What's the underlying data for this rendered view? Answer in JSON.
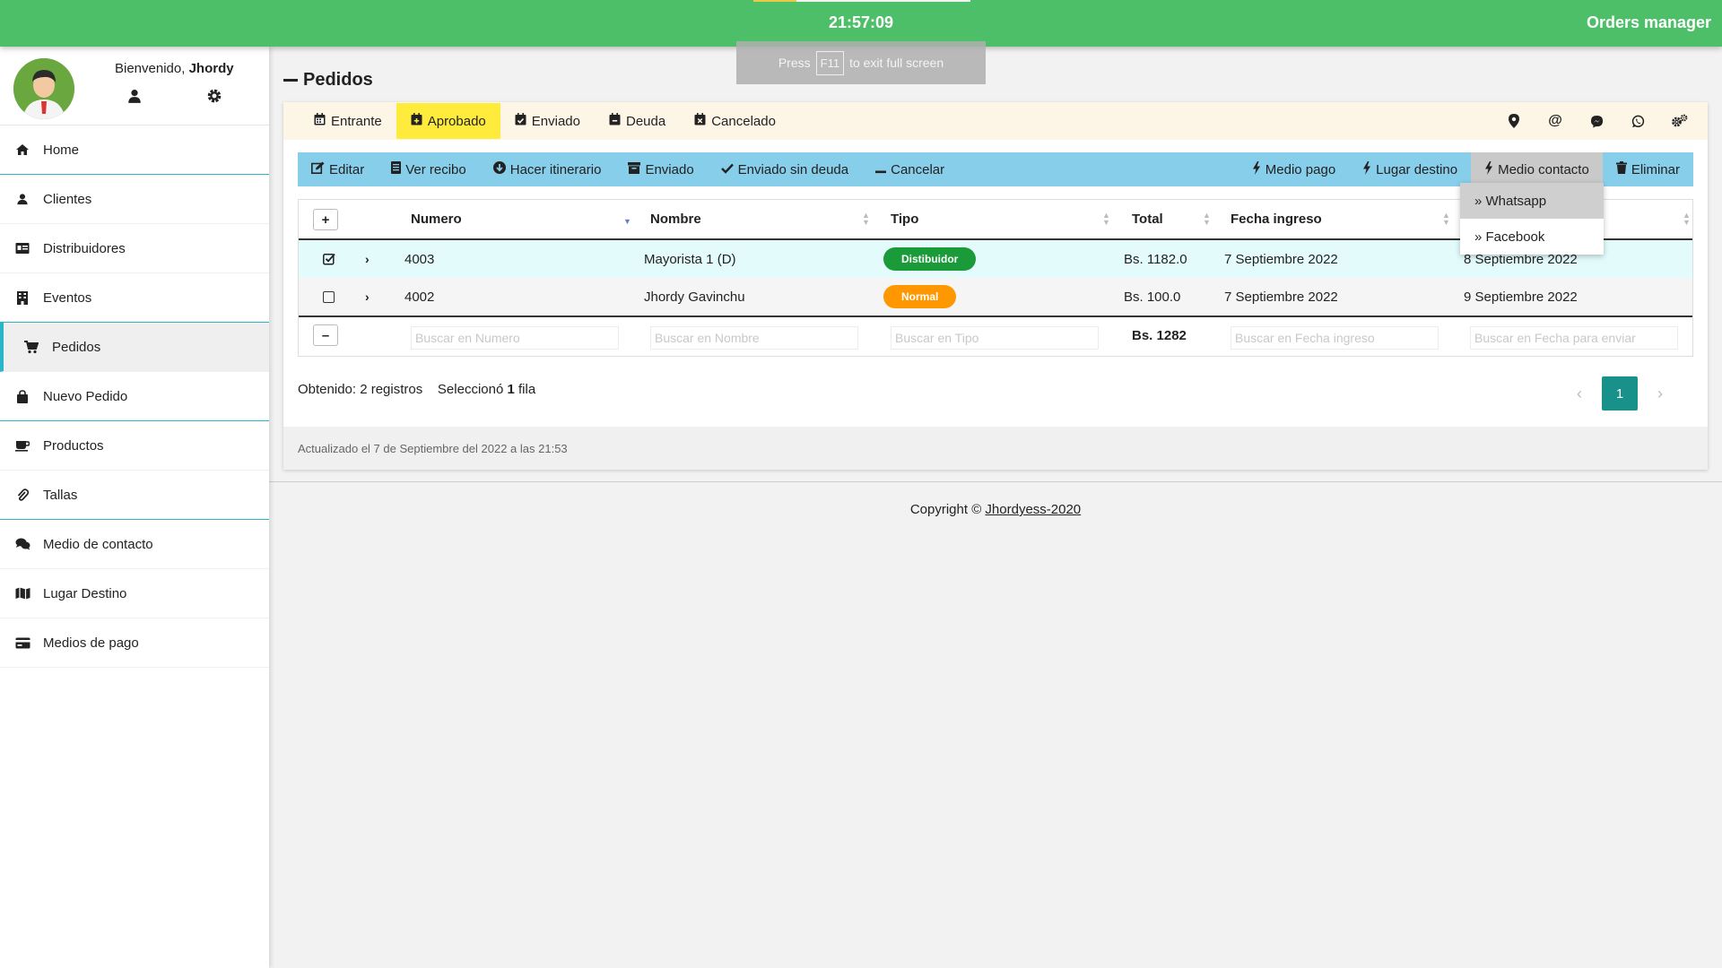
{
  "header": {
    "clock": "21:57:09",
    "app_title": "Orders manager"
  },
  "fullscreen_hint": {
    "press": "Press",
    "key": "F11",
    "rest": "to exit full screen"
  },
  "user": {
    "welcome": "Bienvenido,",
    "name": "Jhordy"
  },
  "sidebar": {
    "items": [
      {
        "label": "Home",
        "icon": "home-icon"
      },
      {
        "label": "Clientes",
        "icon": "user-icon"
      },
      {
        "label": "Distribuidores",
        "icon": "id-card-icon"
      },
      {
        "label": "Eventos",
        "icon": "building-icon"
      },
      {
        "label": "Pedidos",
        "icon": "cart-icon"
      },
      {
        "label": "Nuevo Pedido",
        "icon": "bag-icon"
      },
      {
        "label": "Productos",
        "icon": "coffee-icon"
      },
      {
        "label": "Tallas",
        "icon": "paperclip-icon"
      },
      {
        "label": "Medio de contacto",
        "icon": "comments-icon"
      },
      {
        "label": "Lugar Destino",
        "icon": "map-icon"
      },
      {
        "label": "Medios de pago",
        "icon": "credit-card-icon"
      }
    ]
  },
  "page": {
    "title": "Pedidos"
  },
  "tabs": [
    "Entrante",
    "Aprobado",
    "Enviado",
    "Deuda",
    "Cancelado"
  ],
  "toolbar": {
    "editar": "Editar",
    "ver_recibo": "Ver recibo",
    "hacer_itinerario": "Hacer itinerario",
    "enviado": "Enviado",
    "enviado_sin_deuda": "Enviado sin deuda",
    "cancelar": "Cancelar",
    "medio_pago": "Medio pago",
    "lugar_destino": "Lugar destino",
    "medio_contacto": "Medio contacto",
    "eliminar": "Eliminar"
  },
  "dropdown": [
    "» Whatsapp",
    "» Facebook"
  ],
  "table": {
    "columns": [
      "Numero",
      "Nombre",
      "Tipo",
      "Total",
      "Fecha ingreso"
    ],
    "rows": [
      {
        "numero": "4003",
        "nombre": "Mayorista 1 (D)",
        "tipo": "Distibuidor",
        "total": "Bs. 1182.0",
        "fecha_ingreso": "7 Septiembre 2022",
        "fecha_envio": "8 Septiembre 2022"
      },
      {
        "numero": "4002",
        "nombre": "Jhordy Gavinchu",
        "tipo": "Normal",
        "total": "Bs. 100.0",
        "fecha_ingreso": "7 Septiembre 2022",
        "fecha_envio": "9 Septiembre 2022"
      }
    ],
    "search_placeholders": {
      "numero": "Buscar en Numero",
      "nombre": "Buscar en Nombre",
      "tipo": "Buscar en Tipo",
      "fecha_ingreso": "Buscar en Fecha ingreso",
      "fecha_envio": "Buscar en Fecha para enviar"
    },
    "total_sum": "Bs. 1282"
  },
  "summary": {
    "obtained": "Obtenido: 2 registros",
    "selected_pre": "Seleccionó",
    "selected_count": "1",
    "selected_post": "fila"
  },
  "pagination": {
    "current": "1"
  },
  "card_footer": "Actualizado el 7 de Septiembre del 2022 a las 21:53",
  "footer": {
    "copyright": "Copyright ©",
    "link": "Jhordyess-2020"
  },
  "colors": {
    "header": "#4ebf69",
    "toolbar": "#87ceeb",
    "active_tab": "#ffeb3b",
    "distribuidor": "#1a9a38",
    "normal": "#ff9800",
    "pager": "#17918a",
    "sidebar_accent": "#29b6c8"
  }
}
